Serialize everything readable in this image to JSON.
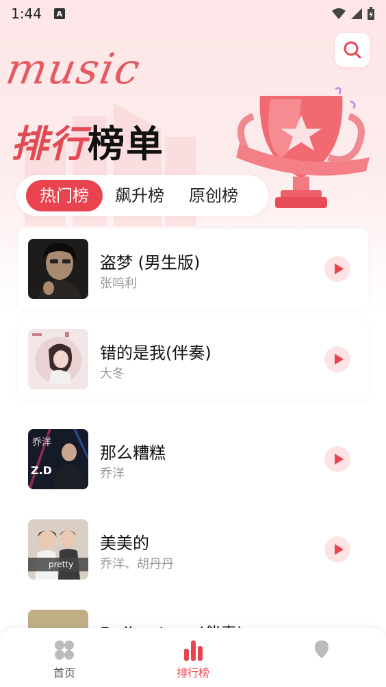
{
  "status_bar": {
    "time": "1:44",
    "notification_icon": "A"
  },
  "header": {
    "logo_text": "music",
    "title_part1": "排行",
    "title_part2": "榜单"
  },
  "tabs": [
    {
      "label": "热门榜",
      "active": true
    },
    {
      "label": "飙升榜",
      "active": false
    },
    {
      "label": "原创榜",
      "active": false
    }
  ],
  "songs": [
    {
      "title": "盗梦 (男生版)",
      "artist": "张鸣利"
    },
    {
      "title": "错的是我(伴奏)",
      "artist": "大冬"
    },
    {
      "title": "那么糟糕",
      "artist": "乔洋"
    },
    {
      "title": "美美的",
      "artist": "乔洋、胡丹丹",
      "cover_text": "pretty"
    },
    {
      "title": "Fading Love(伴奏)",
      "artist": ""
    }
  ],
  "covers": {
    "song3_text": "乔洋",
    "song3_logo": "Z.D"
  },
  "bottom_nav": [
    {
      "label": "首页",
      "icon": "grid-icon",
      "active": false
    },
    {
      "label": "排行榜",
      "icon": "chart-bars-icon",
      "active": true
    },
    {
      "label": "",
      "icon": "location-pin-icon",
      "active": false
    }
  ],
  "colors": {
    "accent": "#e8434f",
    "logo": "#e25b63",
    "bg_top": "#fde6e7"
  }
}
